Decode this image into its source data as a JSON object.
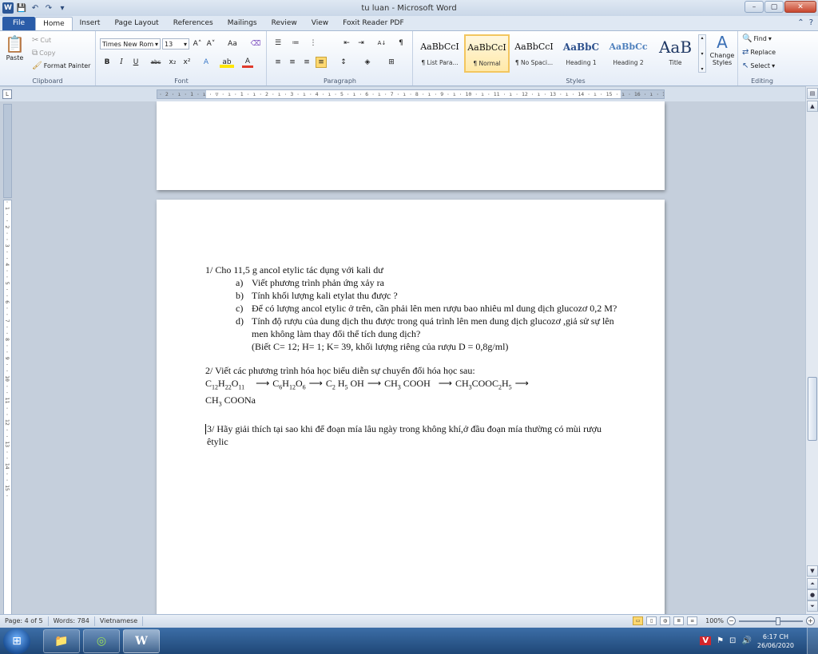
{
  "window": {
    "title": "tu luan - Microsoft Word",
    "app_icon": "W",
    "minimize": "–",
    "maximize": "▢",
    "close": "✕"
  },
  "qat": {
    "save": "💾",
    "undo": "↶",
    "redo": "↷",
    "more": "▾"
  },
  "tabs": [
    "File",
    "Home",
    "Insert",
    "Page Layout",
    "References",
    "Mailings",
    "Review",
    "View",
    "Foxit Reader PDF"
  ],
  "ribbon": {
    "clipboard": {
      "label": "Clipboard",
      "paste": "Paste",
      "cut": "Cut",
      "copy": "Copy",
      "format_painter": "Format Painter"
    },
    "font": {
      "label": "Font",
      "name": "Times New Rom",
      "size": "13",
      "bold": "B",
      "italic": "I",
      "underline": "U",
      "strike": "abc",
      "subscript": "x₂",
      "superscript": "x²",
      "grow": "A˄",
      "shrink": "A˅",
      "case": "Aa",
      "clear": "⌫",
      "effects": "A",
      "highlight": "ab",
      "color": "A"
    },
    "paragraph": {
      "label": "Paragraph",
      "pilcrow": "¶",
      "sort": "A↓"
    },
    "styles": {
      "label": "Styles",
      "items": [
        {
          "sample": "AaBbCcI",
          "name": "¶ List Para..."
        },
        {
          "sample": "AaBbCcI",
          "name": "¶ Normal"
        },
        {
          "sample": "AaBbCcI",
          "name": "¶ No Spaci..."
        },
        {
          "sample": "AaBbC",
          "name": "Heading 1"
        },
        {
          "sample": "AaBbCc",
          "name": "Heading 2"
        },
        {
          "sample": "AaB",
          "name": "Title"
        }
      ],
      "change_styles": "Change Styles"
    },
    "editing": {
      "label": "Editing",
      "find": "Find",
      "replace": "Replace",
      "select": "Select"
    }
  },
  "ruler": {
    "h_marks": "· 2 · ı · 1 · ı · ▽ · ı · 1 · ı · 2 · ı · 3 · ı · 4 · ı · 5 · ı · 6 · ı · 7 · ı · 8 · ı · 9 · ı · 10 · ı · 11 · ı · 12 · ı · 13 · ı · 14 · ı · 15 · ı · 16 · ı · 17 · ı · 18 ·",
    "v_marks": "· 1 · · 2 · · 3 · · 4 · · 5 · · 6 · · 7 · · 8 · · 9 · · 10 · · 11 · · 12 · · 13 · · 14 · · 15 ·"
  },
  "document": {
    "q1": "1/  Cho 11,5 g ancol  etylic  tác dụng  với kali dư",
    "q1_items": [
      {
        "label": "a)",
        "text": "Viết phương trình phản ứng xảy ra"
      },
      {
        "label": "b)",
        "text": "Tính khối lượng kali etylat thu được ?"
      },
      {
        "label": "c)",
        "text": "Để có lượng ancol etylic ở  trên,  cần phải lên men rượu   bao nhiêu ml dung dịch glucozơ 0,2 M?"
      },
      {
        "label": "d)",
        "text": "Tính độ rượu của dung dịch thu được trong quá trình lên men dung dịch glucozơ ,giả sử sự lên men không làm thay đổi thể tích dung dịch?"
      }
    ],
    "q1_note": "(Biết C= 12; H= 1; K= 39, khối lượng riêng của rượu D = 0,8g/ml)",
    "q2": "2/ Viết các phương trình hóa học biểu diễn sự chuyển đổi hóa học sau:",
    "chain": {
      "s1": "C",
      "s1a": "12",
      "s1b": "H",
      "s1c": "22",
      "s1d": "O",
      "s1e": "11",
      "s2": "C",
      "s2a": "6",
      "s2b": "H",
      "s2c": "12",
      "s2d": "O",
      "s2e": "6",
      "s3": "C",
      "s3a": "2",
      "s3b": "H",
      "s3c": "5",
      "s3d": "OH",
      "s4": "CH",
      "s4a": "3",
      "s4b": "COOH",
      "s5": "CH",
      "s5a": "3",
      "s5b": "COOC",
      "s5c": "2",
      "s5d": "H",
      "s5e": "5",
      "s6": "CH",
      "s6a": "3",
      "s6b": "COONa",
      "arrow": "⟶"
    },
    "q3": "3/ Hãy giải thích tại sao khi để đoạn mía lâu ngày trong không  khí,ở đầu đoạn mía thường có mùi rượu êtylic"
  },
  "status": {
    "page": "Page: 4 of 5",
    "words": "Words: 784",
    "language": "Vietnamese",
    "zoom": "100%"
  },
  "taskbar": {
    "start": "⊞",
    "apps": [
      "📁",
      "◎",
      "W"
    ],
    "tray": [
      "V",
      "⚑",
      "⊡",
      "🔊"
    ],
    "time": "6:17 CH",
    "date": "26/06/2020"
  }
}
